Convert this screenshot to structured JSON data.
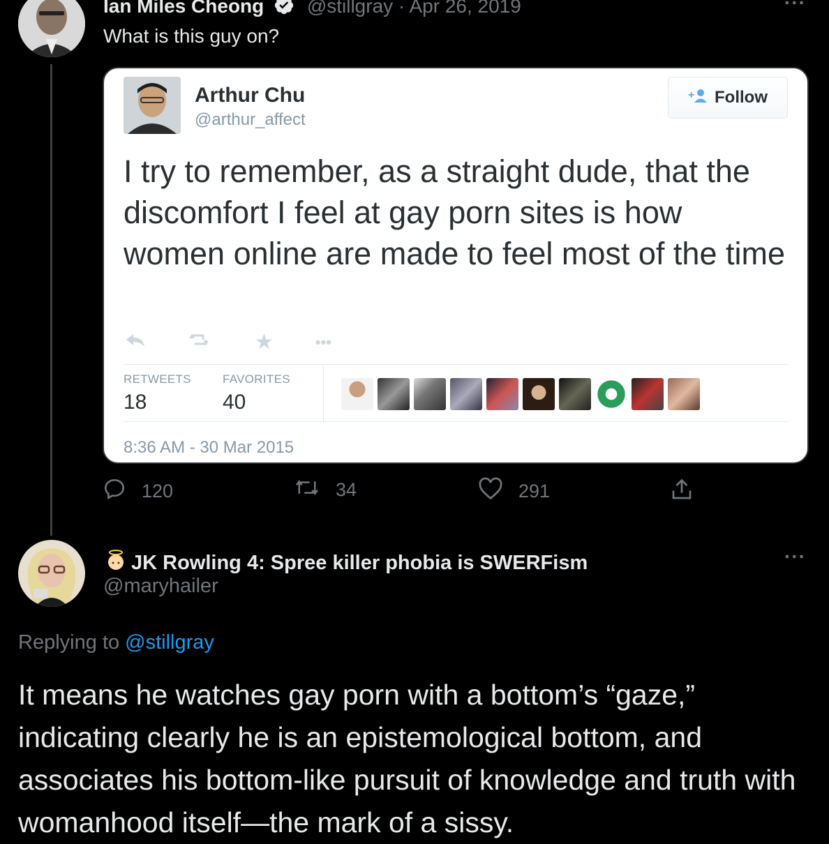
{
  "tweet1": {
    "author_name": "Ian Miles Cheong",
    "handle_date": "@stillgray · Apr 26, 2019",
    "text": "What is this guy on?",
    "more": "···",
    "quoted": {
      "name": "Arthur Chu",
      "handle": "@arthur_affect",
      "follow_label": "Follow",
      "text": "I try to remember, as a straight dude, that the discomfort I feel at gay porn sites is how women online are made to feel most of the time",
      "retweets_label": "RETWEETS",
      "retweets": "18",
      "favorites_label": "FAVORITES",
      "favorites": "40",
      "timestamp": "8:36 AM - 30 Mar 2015"
    },
    "replies": "120",
    "retweets": "34",
    "likes": "291"
  },
  "tweet2": {
    "author_name": "JK Rowling 4: Spree killer phobia is SWERFism",
    "handle": "@maryhailer",
    "more": "···",
    "replying_prefix": "Replying to",
    "replying_to": "@stillgray",
    "text": "It means he watches gay porn with a bottom’s “gaze,” indicating clearly he is an epistemological bottom, and associates his bottom-like pursuit of knowledge and truth with womanhood itself—the mark of a sissy."
  },
  "colors": {
    "background": "#000000",
    "link": "#1d9bf0",
    "muted": "#71767b",
    "verified": "#e7e9ea"
  }
}
